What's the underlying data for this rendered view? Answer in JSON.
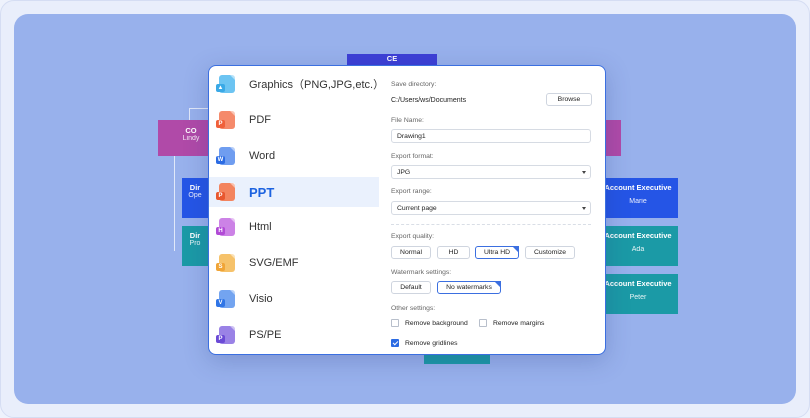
{
  "background": {
    "nodes": [
      {
        "id": "top",
        "title": "CE",
        "subtitle": ""
      },
      {
        "id": "co",
        "title": "CO",
        "subtitle": "Lindy"
      },
      {
        "id": "dir1",
        "title": "Dir",
        "subtitle": "Ope"
      },
      {
        "id": "dir2",
        "title": "Dir",
        "subtitle": "Pro"
      },
      {
        "id": "acct1",
        "title": "Account Executive",
        "subtitle": "Marie"
      },
      {
        "id": "acct2",
        "title": "Account Executive",
        "subtitle": "Ada"
      },
      {
        "id": "acct3",
        "title": "Account Executive",
        "subtitle": "Peter"
      }
    ]
  },
  "dialog": {
    "formats": [
      {
        "label": "Graphics（PNG,JPG,etc.）",
        "icon": "image-file-icon",
        "color": "#3aa9e6",
        "badge": ""
      },
      {
        "label": "PDF",
        "icon": "pdf-file-icon",
        "color": "#f0603a",
        "badge": "P"
      },
      {
        "label": "Word",
        "icon": "word-file-icon",
        "color": "#2b6be3",
        "badge": "W"
      },
      {
        "label": "PPT",
        "icon": "ppt-file-icon",
        "color": "#e8572f",
        "badge": "P"
      },
      {
        "label": "Html",
        "icon": "html-file-icon",
        "color": "#b14ad6",
        "badge": "H"
      },
      {
        "label": "SVG/EMF",
        "icon": "svg-file-icon",
        "color": "#f0a436",
        "badge": "S"
      },
      {
        "label": "Visio",
        "icon": "visio-file-icon",
        "color": "#2f75e6",
        "badge": "V"
      },
      {
        "label": "PS/PE",
        "icon": "ps-file-icon",
        "color": "#6b4ad6",
        "badge": "P"
      }
    ],
    "selected_format": "PPT",
    "save_directory": {
      "label": "Save directory:",
      "value": "C:/Users/ws/Documents",
      "browse": "Browse"
    },
    "file_name": {
      "label": "File Name:",
      "value": "Drawing1"
    },
    "export_format": {
      "label": "Export format:",
      "value": "JPG"
    },
    "export_range": {
      "label": "Export range:",
      "value": "Current page"
    },
    "export_quality": {
      "label": "Export quality:",
      "options": [
        "Normal",
        "HD",
        "Ultra HD",
        "Customize"
      ],
      "selected": "Ultra HD"
    },
    "watermark": {
      "label": "Watermark settings:",
      "options": [
        "Default",
        "No watermarks"
      ],
      "selected": "No watermarks"
    },
    "other_settings": {
      "label": "Other settings:",
      "remove_background": {
        "label": "Remove background",
        "checked": false
      },
      "remove_margins": {
        "label": "Remove margins",
        "checked": false
      },
      "remove_gridlines": {
        "label": "Remove gridlines",
        "checked": true
      }
    }
  },
  "colors": {
    "accent": "#2b6be3",
    "canvas": "#98b1ec",
    "purple_node": "#b04aa8",
    "blue_node": "#2555e6",
    "teal_node": "#1b9aa6"
  }
}
